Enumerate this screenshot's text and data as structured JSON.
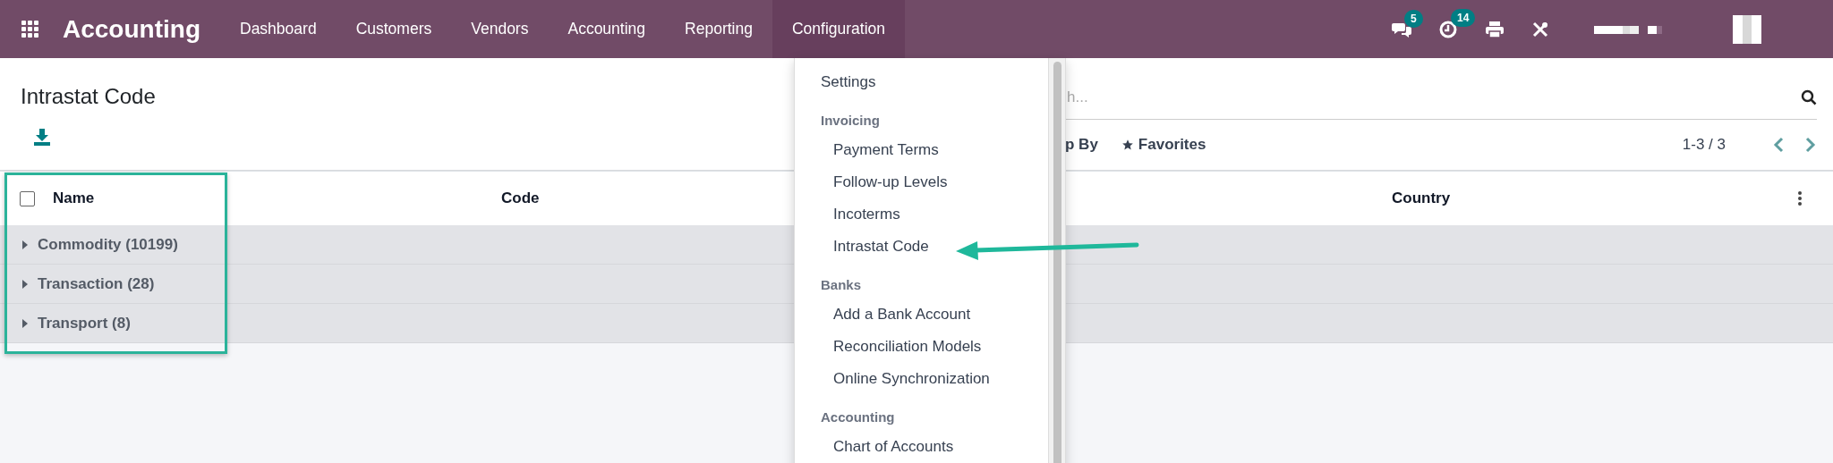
{
  "navbar": {
    "app_name": "Accounting",
    "menu": [
      {
        "label": "Dashboard",
        "selected": false
      },
      {
        "label": "Customers",
        "selected": false
      },
      {
        "label": "Vendors",
        "selected": false
      },
      {
        "label": "Accounting",
        "selected": false
      },
      {
        "label": "Reporting",
        "selected": false
      },
      {
        "label": "Configuration",
        "selected": true
      }
    ],
    "notifications": [
      {
        "kind": "messages",
        "count": "5"
      },
      {
        "kind": "activities",
        "count": "14"
      }
    ]
  },
  "page": {
    "title": "Intrastat Code"
  },
  "search": {
    "placeholder": "h..."
  },
  "filters": [
    {
      "kind": "plain",
      "label": "p By"
    },
    {
      "kind": "star",
      "label": "Favorites"
    }
  ],
  "pager": {
    "range": "1-3 / 3"
  },
  "table": {
    "select_all": {
      "checked": false
    },
    "columns": [
      "Name",
      "Code",
      "Country"
    ],
    "groups": [
      {
        "label": "Commodity (10199)",
        "expanded": false
      },
      {
        "label": "Transaction (28)",
        "expanded": false
      },
      {
        "label": "Transport (8)",
        "expanded": false
      }
    ]
  },
  "dropdown": {
    "items": [
      {
        "kind": "item",
        "label": "Settings"
      },
      {
        "kind": "header",
        "label": "Invoicing"
      },
      {
        "kind": "subitem",
        "label": "Payment Terms"
      },
      {
        "kind": "subitem",
        "label": "Follow-up Levels"
      },
      {
        "kind": "subitem",
        "label": "Incoterms"
      },
      {
        "kind": "subitem",
        "label": "Intrastat Code"
      },
      {
        "kind": "header",
        "label": "Banks"
      },
      {
        "kind": "subitem",
        "label": "Add a Bank Account"
      },
      {
        "kind": "subitem",
        "label": "Reconciliation Models"
      },
      {
        "kind": "subitem",
        "label": "Online Synchronization"
      },
      {
        "kind": "header",
        "label": "Accounting"
      },
      {
        "kind": "subitem",
        "label": "Chart of Accounts"
      }
    ]
  }
}
